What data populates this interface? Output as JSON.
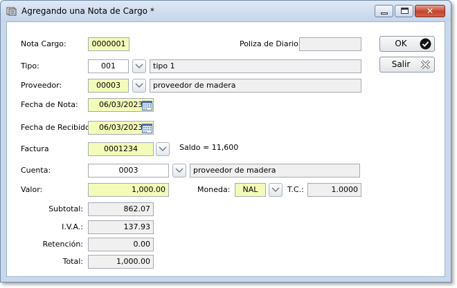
{
  "window": {
    "title": "Agregando una Nota de Cargo *"
  },
  "form": {
    "nota_cargo": {
      "label": "Nota Cargo:",
      "value": "0000001"
    },
    "poliza": {
      "label": "Poliza de Diario:",
      "value": ""
    },
    "tipo": {
      "label": "Tipo:",
      "code": "001",
      "desc": "tipo 1"
    },
    "proveedor": {
      "label": "Proveedor:",
      "code": "00003",
      "desc": "proveedor de madera"
    },
    "fecha_nota": {
      "label": "Fecha de Nota:",
      "value": "06/03/2023"
    },
    "fecha_recibido": {
      "label": "Fecha de Recibido:",
      "value": "06/03/2023"
    },
    "factura": {
      "label": "Factura",
      "value": "0001234",
      "saldo": "Saldo = 11,600"
    },
    "cuenta": {
      "label": "Cuenta:",
      "code": "0003",
      "desc": "proveedor de madera"
    },
    "valor": {
      "label": "Valor:",
      "value": "1,000.00"
    },
    "moneda": {
      "label": "Moneda:",
      "value": "NAL"
    },
    "tc": {
      "label": "T.C.:",
      "value": "1.0000"
    },
    "subtotal": {
      "label": "Subtotal:",
      "value": "862.07"
    },
    "iva": {
      "label": "I.V.A.:",
      "value": "137.93"
    },
    "retencion": {
      "label": "Retención:",
      "value": "0.00"
    },
    "total": {
      "label": "Total:",
      "value": "1,000.00"
    }
  },
  "buttons": {
    "ok": "OK",
    "salir": "Salir"
  },
  "icons": {
    "app": "app-icon",
    "minimize": "minimize-icon",
    "maximize": "maximize-icon",
    "close": "close-icon",
    "dropdown": "chevron-down-icon",
    "calendar": "calendar-icon",
    "ok": "checkmark-icon",
    "salir": "exit-icon"
  },
  "colors": {
    "required_field": "#f4fbb8",
    "readonly_field": "#f0f0f0",
    "frame": "#c9d9ec"
  }
}
